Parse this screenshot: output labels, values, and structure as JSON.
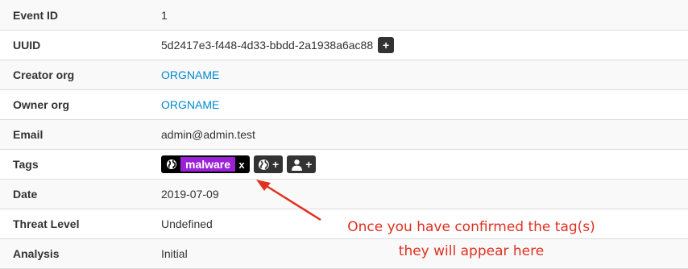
{
  "rows": {
    "event_id": {
      "label": "Event ID",
      "value": "1"
    },
    "uuid": {
      "label": "UUID",
      "value": "5d2417e3-f448-4d33-bbdd-2a1938a6ac88",
      "button": "+"
    },
    "creator_org": {
      "label": "Creator org",
      "value": "ORGNAME"
    },
    "owner_org": {
      "label": "Owner org",
      "value": "ORGNAME"
    },
    "email": {
      "label": "Email",
      "value": "admin@admin.test"
    },
    "tags": {
      "label": "Tags",
      "tag": {
        "icon": "globe-icon",
        "name": "malware",
        "remove": "x",
        "color": "#9b20d6"
      },
      "add_global_tag_label": "+",
      "add_local_tag_label": "+"
    },
    "date": {
      "label": "Date",
      "value": "2019-07-09"
    },
    "threat_level": {
      "label": "Threat Level",
      "value": "Undefined"
    },
    "analysis": {
      "label": "Analysis",
      "value": "Initial"
    }
  },
  "annotation": {
    "line1": "Once you have confirmed the tag(s)",
    "line2": "they will appear here",
    "color": "#e03020"
  }
}
